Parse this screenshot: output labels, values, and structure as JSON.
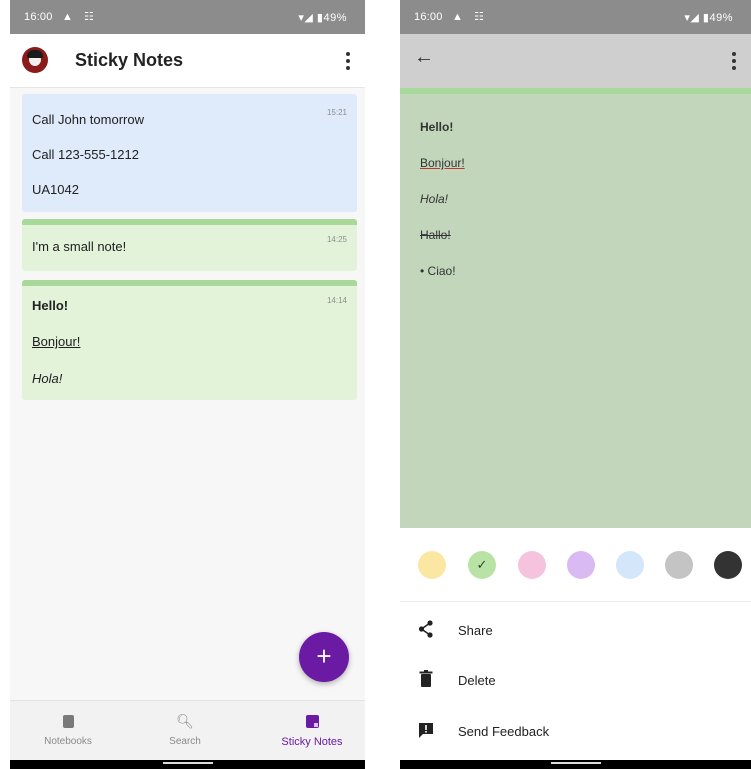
{
  "left": {
    "status": {
      "time": "16:00",
      "icons": "▲ ☷",
      "battery": "▾◢ ▮49%"
    },
    "appbar": {
      "title": "Sticky Notes"
    },
    "notes": [
      {
        "lines": [
          "Call John tomorrow",
          "Call 123-555-1212",
          "UA1042"
        ],
        "time": "15:21"
      },
      {
        "lines": [
          "I'm a small note!"
        ],
        "time": "14:25"
      },
      {
        "lines": [
          "Hello!",
          "Bonjour!",
          "Hola!"
        ],
        "time": "14:14"
      }
    ],
    "fab": {
      "label": "+"
    },
    "nav": [
      {
        "label": "Notebooks"
      },
      {
        "label": "Search"
      },
      {
        "label": "Sticky Notes"
      }
    ]
  },
  "right": {
    "status": {
      "time": "16:00",
      "icons": "▲ ☷",
      "battery": "▾◢ ▮49%"
    },
    "editor": {
      "lines": [
        "Hello!",
        "Bonjour!",
        "Hola!",
        "Hallo!",
        "• Ciao!"
      ]
    },
    "swatches": [
      {
        "name": "yellow",
        "color": "#fbe7a1"
      },
      {
        "name": "green",
        "color": "#b9e3a6",
        "selected": true
      },
      {
        "name": "pink",
        "color": "#f5c3de"
      },
      {
        "name": "purple",
        "color": "#d9baf3"
      },
      {
        "name": "blue",
        "color": "#d4e6fa"
      },
      {
        "name": "gray",
        "color": "#c4c4c4"
      },
      {
        "name": "charcoal",
        "color": "#333333"
      }
    ],
    "menu": [
      {
        "label": "Share",
        "icon": "share-icon"
      },
      {
        "label": "Delete",
        "icon": "delete-icon"
      },
      {
        "label": "Send Feedback",
        "icon": "feedback-icon"
      }
    ]
  },
  "colors": {
    "accent_purple": "#6b1aa3",
    "note_blue": "#dfeafb",
    "note_green": "#e3f3da",
    "note_green_strip": "#a8d99a",
    "editor_bg": "#c2d6bc"
  }
}
